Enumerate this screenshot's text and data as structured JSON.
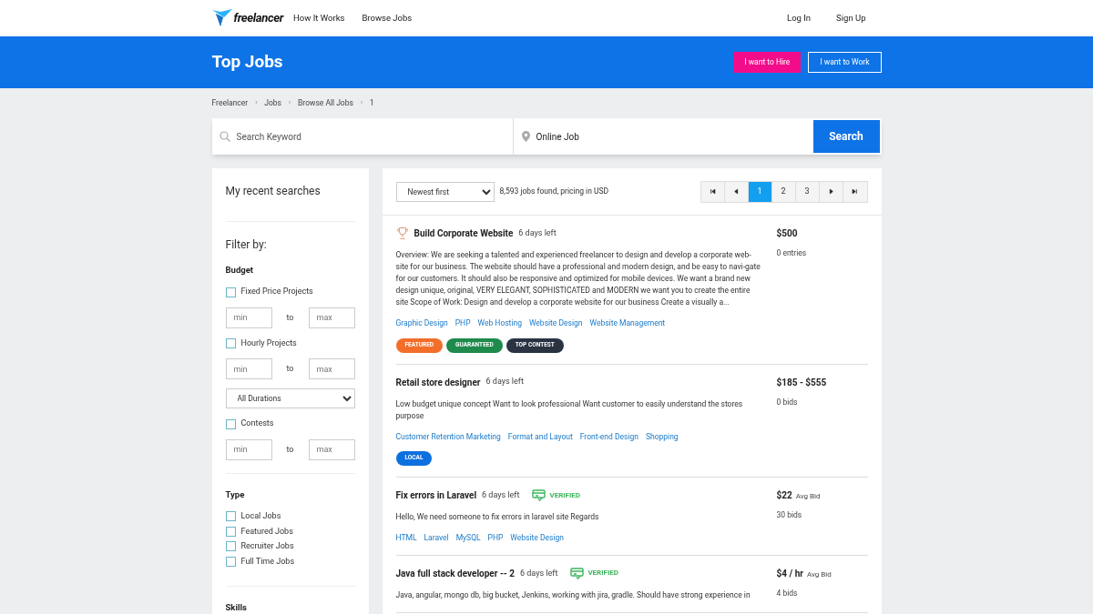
{
  "nav": {
    "logo": "freelancer",
    "links": [
      "How It Works",
      "Browse Jobs"
    ],
    "right": [
      "Log In",
      "Sign Up"
    ]
  },
  "banner": {
    "title": "Top Jobs",
    "buttons": [
      {
        "label": "I want to Hire",
        "kind": "primary"
      },
      {
        "label": "I want to Work",
        "kind": "outline"
      }
    ]
  },
  "breadcrumb": {
    "separator": "›",
    "items": [
      "Freelancer",
      "Jobs",
      "Browse All Jobs",
      "1"
    ]
  },
  "search": {
    "keyword_placeholder": "Search Keyword",
    "location_value": "Online Job",
    "button": "Search"
  },
  "sidebar": {
    "recent": "My recent searches",
    "filter_title": "Filter by:",
    "budget": {
      "title": "Budget",
      "groups": [
        {
          "label": "Fixed Price Projects",
          "checked": false,
          "min": {
            "placeholder": "min"
          },
          "to": "to",
          "max": {
            "placeholder": "max"
          }
        },
        {
          "label": "Hourly Projects",
          "checked": false,
          "min": {
            "placeholder": "min"
          },
          "to": "to",
          "max": {
            "placeholder": "max"
          },
          "select": "All Durations"
        },
        {
          "label": "Contests",
          "checked": false,
          "min": {
            "placeholder": "min"
          },
          "to": "to",
          "max": {
            "placeholder": "max"
          }
        }
      ]
    },
    "type": {
      "title": "Type",
      "items": [
        {
          "label": "Local Jobs",
          "checked": false
        },
        {
          "label": "Featured Jobs",
          "checked": false
        },
        {
          "label": "Recruiter Jobs",
          "checked": false
        },
        {
          "label": "Full Time Jobs",
          "checked": false
        }
      ]
    },
    "skills": {
      "title": "Skills"
    }
  },
  "results": {
    "sort": "Newest first",
    "count": "8,593 jobs found, pricing in USD",
    "pagination": [
      {
        "kind": "first",
        "selected": false
      },
      {
        "kind": "prev",
        "selected": false
      },
      {
        "label": "1",
        "kind": "page",
        "selected": true
      },
      {
        "label": "2",
        "kind": "page",
        "selected": false
      },
      {
        "label": "3",
        "kind": "page",
        "selected": false
      },
      {
        "kind": "next",
        "selected": false
      },
      {
        "kind": "last",
        "selected": false
      }
    ],
    "jobs": [
      {
        "title": "Build Corporate Website",
        "contest": true,
        "time": "6 days left",
        "price": "$500",
        "sub": "0 entries",
        "description": "Overview: We are seeking a talented and experienced freelancer to design and develop a corporate web-site for our business. The website should have a professional and modern design, and be easy to navi-gate for our customers. It should also be responsive and optimized for mobile devices. We want a brand new design unique, original, VERY ELEGANT, SOPHISTICATED and MODERN we want you to create the entire site Scope of Work: Design and develop a corporate website for our business Create a visually a...",
        "skills": [
          "Graphic Design",
          "PHP",
          "Web Hosting",
          "Website Design",
          "Website Management"
        ],
        "badges": [
          {
            "label": "FEATURED",
            "color": "#f26e2a"
          },
          {
            "label": "GUARANTEED",
            "color": "#1e8a4c"
          },
          {
            "label": "TOP CONTEST",
            "color": "#2a3342"
          }
        ]
      },
      {
        "title": "Retail store designer",
        "contest": false,
        "time": "6 days left",
        "price": "$185 - $555",
        "sub": "0 bids",
        "description": "Low budget unique concept Want to look professional Want customer to easily understand the stores purpose",
        "skills": [
          "Customer Retention Marketing",
          "Format and Layout",
          "Front-end Design",
          "Shopping"
        ],
        "badges": [
          {
            "label": "LOCAL",
            "color": "#0e70e0"
          }
        ]
      },
      {
        "title": "Fix errors in Laravel",
        "contest": false,
        "time": "6 days left",
        "verified": "VERIFIED",
        "price": "$22",
        "price_note": "Avg Bid",
        "sub": "30 bids",
        "description": "Hello, We need someone to fix errors in laravel site Regards",
        "skills": [
          "HTML",
          "Laravel",
          "MySQL",
          "PHP",
          "Website Design"
        ]
      },
      {
        "title": "Java full stack developer -- 2",
        "contest": false,
        "time": "6 days left",
        "verified": "VERIFIED",
        "price": "$4 / hr",
        "price_note": "Avg Bid",
        "sub": "4 bids",
        "description": "Java, angular, mongo db, big bucket, Jenkins, working with jira, gradle. Should have strong experience in"
      }
    ]
  }
}
